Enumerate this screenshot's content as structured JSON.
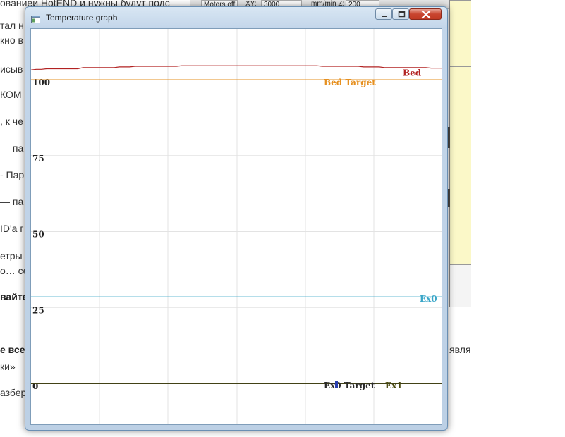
{
  "background": {
    "toolbar": {
      "motors_off": "Motors off",
      "xy": "XY:",
      "speed": "3000",
      "mm_min_z": "mm/min Z:",
      "z_speed": "200"
    },
    "text_fragments": [
      "ованиеи HotEND и нужны будут подс",
      "тал н",
      "кно в",
      "исыв",
      "КОМ",
      ", к че",
      "— па",
      "- Пар",
      "— па",
      "ID'а г",
      "етры",
      "о… се",
      "вайте",
      "е все",
      "явля",
      "ки»",
      "азбер"
    ]
  },
  "window": {
    "title": "Temperature graph",
    "icon": "app-window-icon",
    "controls": {
      "minimize": "minimize-icon",
      "maximize": "maximize-icon",
      "close": "close-icon"
    }
  },
  "chart_data": {
    "type": "line",
    "title": "",
    "xlabel": "",
    "ylabel": "",
    "ylim": [
      0,
      100
    ],
    "y_ticks": [
      "100",
      "75",
      "50",
      "25",
      "0"
    ],
    "grid": true,
    "series": [
      {
        "name": "Bed",
        "color": "#b22222",
        "values": [
          103.2,
          103.4,
          103.4,
          103.6,
          103.6,
          103.6,
          103.6,
          103.6,
          103.6,
          103.6,
          104.0,
          104.0,
          104.0,
          104.0,
          104.0,
          104.0,
          104.0,
          104.2,
          104.2,
          104.2,
          104.4,
          104.4,
          104.4,
          104.4,
          104.4,
          104.4,
          104.4,
          104.4,
          104.4,
          104.6,
          104.6,
          104.6,
          104.6,
          104.6,
          104.6,
          104.6,
          104.6,
          104.6,
          104.6,
          104.6,
          104.6,
          104.6,
          104.6,
          104.6,
          104.6,
          104.6,
          104.6,
          104.6,
          104.6,
          104.6,
          104.6,
          104.6,
          104.6,
          104.6,
          104.6,
          104.6,
          104.4,
          104.4,
          104.4,
          104.4,
          104.4,
          104.4,
          104.4,
          104.4,
          104.2,
          104.2,
          104.2,
          104.2,
          104.0,
          104.0,
          104.0,
          104.0,
          104.0,
          104.0,
          104.0,
          104.0,
          104.0,
          103.8,
          103.8,
          103.8
        ]
      },
      {
        "name": "Bed Target",
        "color": "#e69020",
        "values": [
          100
        ]
      },
      {
        "name": "Ex0",
        "color": "#3aa6c8",
        "values": [
          28.5
        ]
      },
      {
        "name": "Ex0 Target",
        "color": "#2a2a2a",
        "values": [
          0
        ]
      },
      {
        "name": "Ex1",
        "color": "#4a4a10",
        "values": [
          0
        ]
      }
    ]
  }
}
